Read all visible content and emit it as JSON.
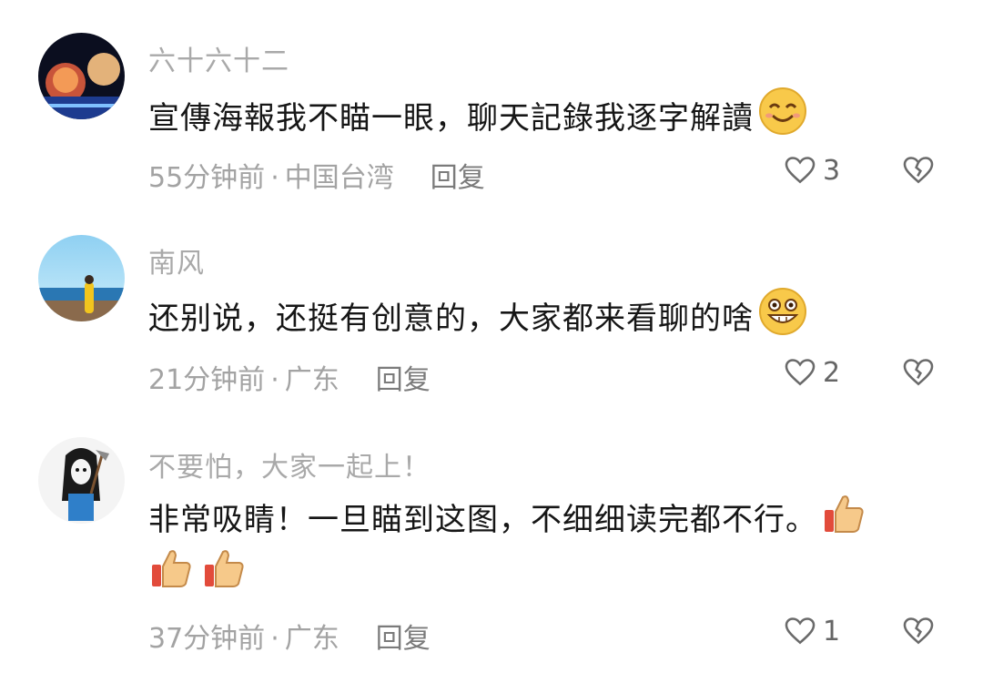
{
  "comments": [
    {
      "username": "六十六十二",
      "text": "宣傳海報我不瞄一眼，聊天記錄我逐字解讀",
      "emoji": "smile-emoji",
      "time": "55分钟前",
      "separator": "·",
      "location": "中国台湾",
      "reply": "回复",
      "likes": "3"
    },
    {
      "username": "南风",
      "text": "还别说，还挺有创意的，大家都来看聊的啥",
      "emoji": "grin-emoji",
      "time": "21分钟前",
      "separator": "·",
      "location": "广东",
      "reply": "回复",
      "likes": "2"
    },
    {
      "username": "不要怕，大家一起上！",
      "text": "非常吸睛！一旦瞄到这图，不细细读完都不行。",
      "emoji": "thumbs-up-emoji",
      "time": "37分钟前",
      "separator": "·",
      "location": "广东",
      "reply": "回复",
      "likes": "1"
    }
  ],
  "colors": {
    "username": "#a9a9a9",
    "meta": "#a3a3a3",
    "text": "#161616",
    "emoji_yellow": "#f8c94a"
  }
}
